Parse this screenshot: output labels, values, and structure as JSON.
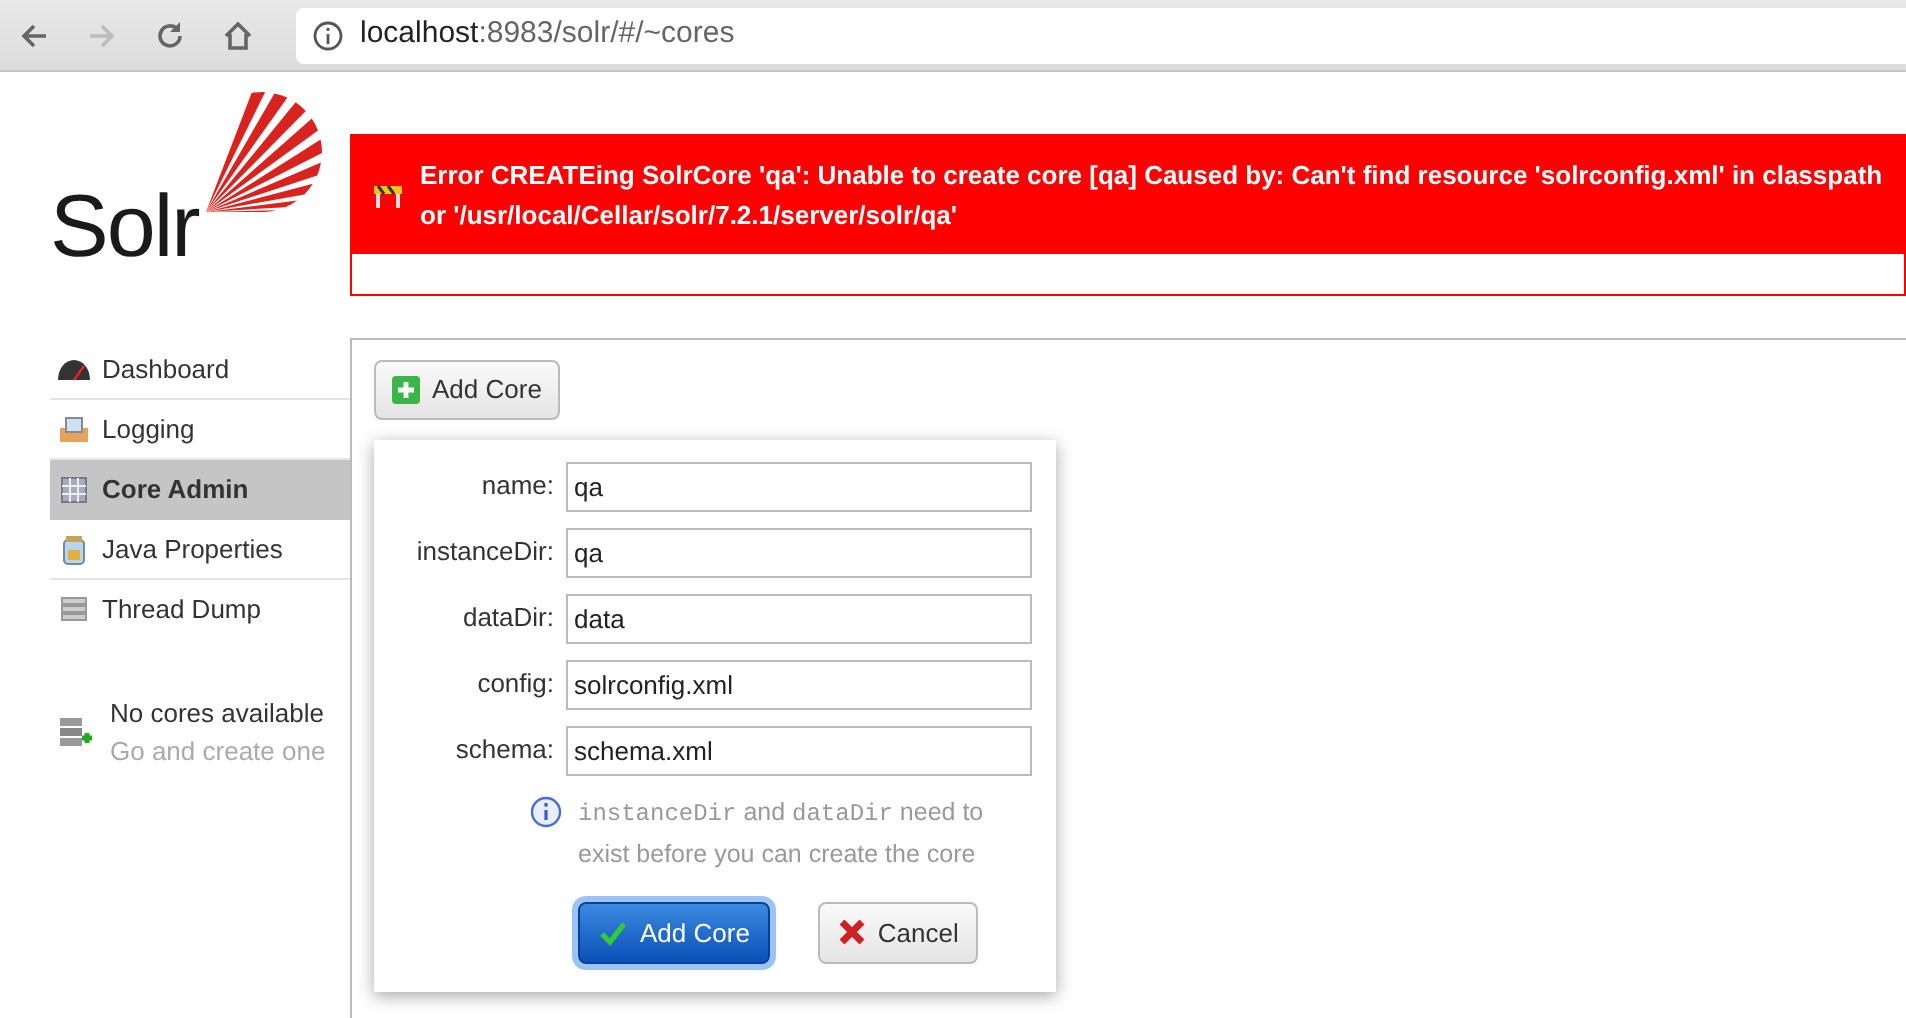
{
  "browser": {
    "nav_buttons": [
      {
        "kind": "back",
        "disabled": false
      },
      {
        "kind": "forward",
        "disabled": true
      },
      {
        "kind": "reload",
        "disabled": false
      },
      {
        "kind": "home",
        "disabled": false
      }
    ],
    "address": {
      "host": "localhost",
      "path": ":8983/solr/#/~cores"
    }
  },
  "logo": {
    "text": "Solr"
  },
  "error": {
    "message": "Error CREATEing SolrCore 'qa': Unable to create core [qa] Caused by: Can't find resource 'solrconfig.xml' in classpath or '/usr/local/Cellar/solr/7.2.1/server/solr/qa'"
  },
  "sidebar": {
    "items": [
      {
        "kind": "dashboard",
        "label": "Dashboard",
        "selected": false
      },
      {
        "kind": "logging",
        "label": "Logging",
        "selected": false
      },
      {
        "kind": "core-admin",
        "label": "Core Admin",
        "selected": true
      },
      {
        "kind": "java",
        "label": "Java Properties",
        "selected": false
      },
      {
        "kind": "thread",
        "label": "Thread Dump",
        "selected": false
      }
    ],
    "cores": {
      "title": "No cores available",
      "hint": "Go and create one"
    }
  },
  "toolbar": {
    "add_button": "Add Core"
  },
  "dialog": {
    "fields": [
      {
        "label": "name:",
        "value": "qa"
      },
      {
        "label": "instanceDir:",
        "value": "qa"
      },
      {
        "label": "dataDir:",
        "value": "data"
      },
      {
        "label": "config:",
        "value": "solrconfig.xml"
      },
      {
        "label": "schema:",
        "value": "schema.xml"
      }
    ],
    "note": [
      {
        "kind": "code",
        "text": "instanceDir"
      },
      {
        "kind": "text",
        "text": " and "
      },
      {
        "kind": "code",
        "text": "dataDir"
      },
      {
        "kind": "text",
        "text": " need to exist before you can create the core"
      }
    ],
    "buttons": [
      {
        "kind": "submit",
        "label": "Add Core"
      },
      {
        "kind": "cancel",
        "label": "Cancel"
      }
    ]
  }
}
